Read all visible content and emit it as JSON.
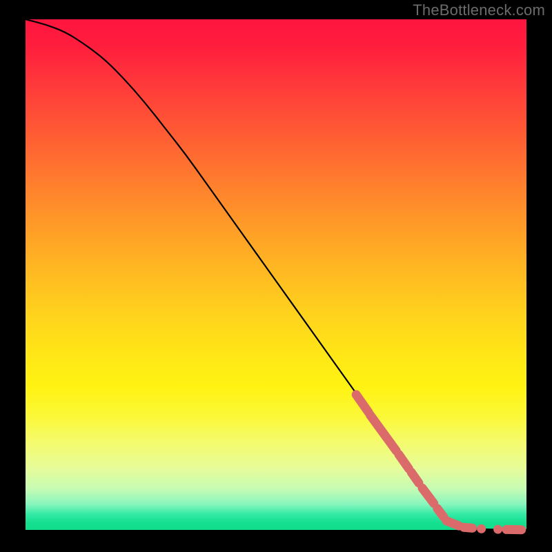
{
  "watermark": "TheBottleneck.com",
  "colors": {
    "marker": "#db6b6b",
    "curve": "#000000",
    "frame": "#000000"
  },
  "chart_data": {
    "type": "line",
    "title": "",
    "xlabel": "",
    "ylabel": "",
    "xlim": [
      0,
      100
    ],
    "ylim": [
      0,
      100
    ],
    "grid": false,
    "legend": false,
    "series": [
      {
        "name": "bottleneck-curve",
        "x": [
          0,
          4,
          8,
          12,
          16,
          20,
          24,
          28,
          32,
          36,
          40,
          44,
          48,
          52,
          56,
          60,
          64,
          68,
          72,
          76,
          80,
          83,
          85,
          88,
          92,
          96,
          100
        ],
        "y": [
          100,
          99,
          97.5,
          95,
          92,
          88,
          83.5,
          78.5,
          73.5,
          68,
          62.5,
          57,
          51.5,
          46,
          40.5,
          35,
          29.5,
          24,
          18.5,
          13,
          7.5,
          3.5,
          1.5,
          0.3,
          0.1,
          0.05,
          0.02
        ]
      }
    ],
    "markers": {
      "name": "highlighted-range",
      "segments_diagonal": [
        {
          "x0": 66,
          "y0": 26.5,
          "x1": 68.5,
          "y1": 23
        },
        {
          "x0": 68.8,
          "y0": 22.5,
          "x1": 74,
          "y1": 15.5
        },
        {
          "x0": 74.5,
          "y0": 14.8,
          "x1": 76.5,
          "y1": 12
        },
        {
          "x0": 77,
          "y0": 11.3,
          "x1": 78.5,
          "y1": 9.2
        },
        {
          "x0": 79.2,
          "y0": 8.2,
          "x1": 81.5,
          "y1": 5.2
        },
        {
          "x0": 82.2,
          "y0": 4.2,
          "x1": 83.5,
          "y1": 2.5
        }
      ],
      "segments_flat": [
        {
          "x0": 84,
          "y0": 1.8,
          "x1": 86.5,
          "y1": 0.8
        },
        {
          "x0": 87.5,
          "y0": 0.5,
          "x1": 89.2,
          "y1": 0.35
        }
      ],
      "points": [
        {
          "x": 91,
          "y": 0.22
        },
        {
          "x": 94.3,
          "y": 0.12
        }
      ],
      "tail": {
        "x0": 96,
        "y0": 0.08,
        "x1": 99,
        "y1": 0.04
      }
    }
  }
}
